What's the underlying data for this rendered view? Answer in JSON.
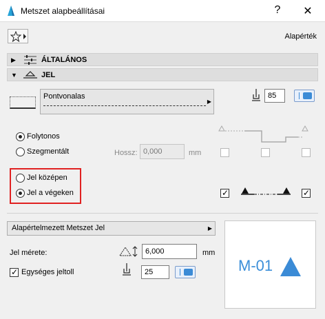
{
  "window": {
    "title": "Metszet alapbeállításai",
    "help_label": "?",
    "close_label": "✕"
  },
  "toolbar": {
    "preset_label": "Alapérték"
  },
  "sections": {
    "general_label": "ÁLTALÁNOS",
    "marker_label": "JEL"
  },
  "line": {
    "linetype_name": "Pontvonalas",
    "pen_value": "85"
  },
  "line_mode": {
    "continuous_label": "Folytonos",
    "segmented_label": "Szegmentált",
    "selected": "continuous",
    "length_label": "Hossz:",
    "length_value": "0,000",
    "length_unit": "mm"
  },
  "marker_position": {
    "middle_label": "Jel középen",
    "ends_label": "Jel a végeken",
    "selected": "ends"
  },
  "marker": {
    "type_name": "Alapértelmezett Metszet Jel",
    "size_label": "Jel mérete:",
    "size_value": "6,000",
    "size_unit": "mm",
    "uniform_pen_label": "Egységes jeltoll",
    "uniform_pen_checked": true,
    "pen_value": "25",
    "preview_text": "M-01"
  },
  "colors": {
    "accent": "#3b8bd6",
    "highlight": "#e02020"
  }
}
